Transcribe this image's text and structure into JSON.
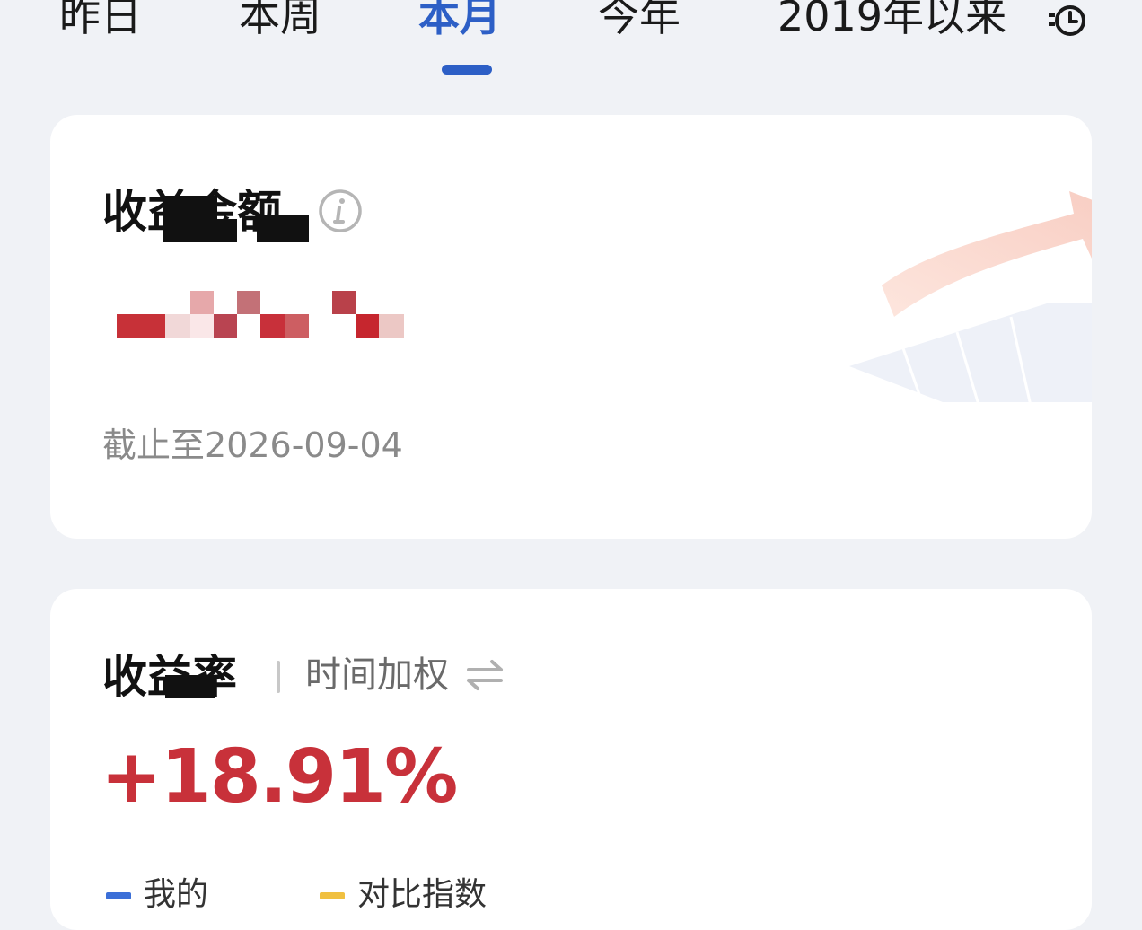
{
  "tabs": [
    {
      "label": "昨日",
      "active": false
    },
    {
      "label": "本周",
      "active": false
    },
    {
      "label": "本月",
      "active": true
    },
    {
      "label": "今年",
      "active": false
    },
    {
      "label": "2019年以来"
    }
  ],
  "colors": {
    "accent": "#2d5fc6",
    "positive": "#c8313a",
    "my_series": "#3b6fd8",
    "compare_series": "#f0c040"
  },
  "amount_card": {
    "title": "收益金额",
    "as_of_label": "截止至",
    "as_of_date": "2026-09-04",
    "info_icon": "info-icon"
  },
  "rate_card": {
    "title": "收益率",
    "mode_label": "时间加权",
    "swap_icon": "swap-arrows-icon",
    "value": "+18.91%",
    "legend": [
      {
        "label": "我的"
      },
      {
        "label": "对比指数"
      }
    ]
  }
}
